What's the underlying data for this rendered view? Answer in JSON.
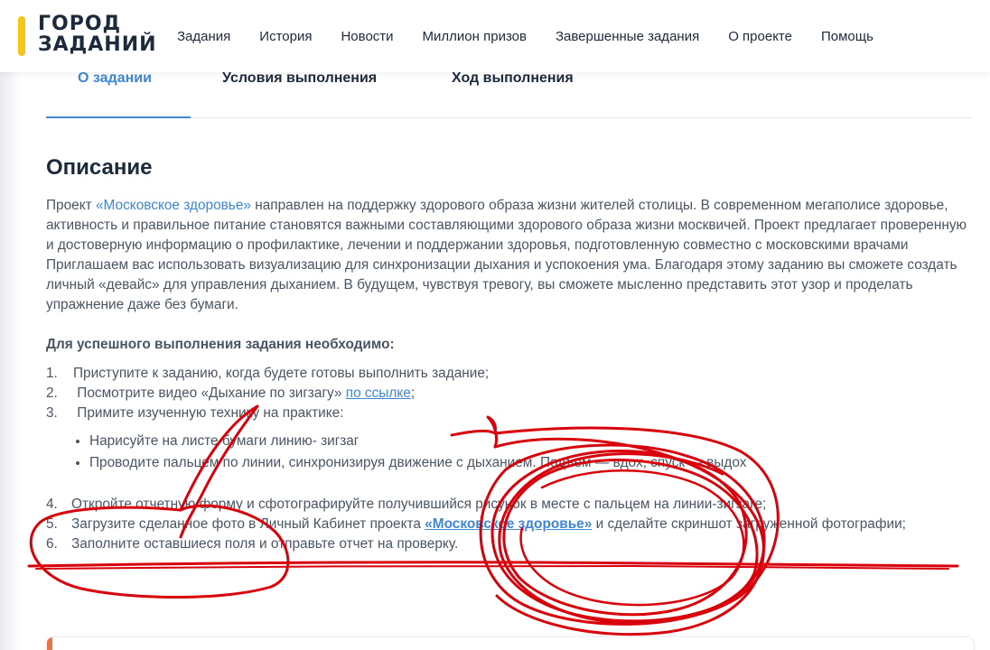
{
  "logo": {
    "line1": "ГОРОД",
    "line2": "ЗАДАНИЙ"
  },
  "nav": {
    "items": [
      "Задания",
      "История",
      "Новости",
      "Миллион призов",
      "Завершенные задания",
      "О проекте",
      "Помощь"
    ]
  },
  "tabs": [
    "О задании",
    "Условия выполнения",
    "Ход выполнения"
  ],
  "colors": {
    "accent": "#3e86d6",
    "logo_bar": "#f5c518",
    "heading": "#1d2a3b",
    "text": "#4a5563",
    "scribble": "#d8000a"
  },
  "description": {
    "title": "Описание",
    "p1_before": "Проект ",
    "p1_link": "«Московское здоровье»",
    "p1_after": " направлен на поддержку здорового образа жизни жителей столицы. В современном мегаполисе здоровье, активность и правильное питание становятся важными составляющими здорового образа жизни москвичей. Проект предлагает проверенную и достоверную информацию о профилактике, лечении и поддержании здоровья, подготовленную совместно с московскими врачами",
    "p2": "Приглашаем вас использовать визуализацию для синхронизации дыхания и успокоения ума. Благодаря этому заданию вы сможете создать личный «девайс» для управления дыханием. В будущем, чувствуя тревогу, вы сможете мысленно представить этот узор и проделать упражнение даже без бумаги.",
    "requirements": "Для успешного выполнения задания необходимо:",
    "steps": [
      {
        "num": "1.",
        "text": "Приступите к заданию, когда будете готовы выполнить задание;"
      },
      {
        "num": "2.",
        "text_before": "Посмотрите видео «Дыхание по зигзагу» ",
        "link": "по ссылке",
        "text_after": ";"
      },
      {
        "num": "3.",
        "text": "Примите изученную технику на практике:"
      }
    ],
    "bullets": [
      "Нарисуйте на листе бумаги линию- зигзаг",
      "Проводите пальцем по линии, синхронизируя движение с дыханием. Подъем — вдох, спуск — выдох"
    ],
    "steps2": [
      {
        "num": "4.",
        "text": "Откройте отчетную форму и сфотографируйте получившийся рисунок в месте с пальцем на линии-зигзаге;"
      },
      {
        "num": "5.",
        "text_before": "Загрузите сделанное фото в Личный Кабинет проекта ",
        "link": "«Московское здоровье»",
        "text_after": " и сделайте скриншот загруженной фотографии;"
      },
      {
        "num": "6.",
        "text": "Заполните оставшиеся поля и отправьте отчет на проверку."
      }
    ]
  }
}
